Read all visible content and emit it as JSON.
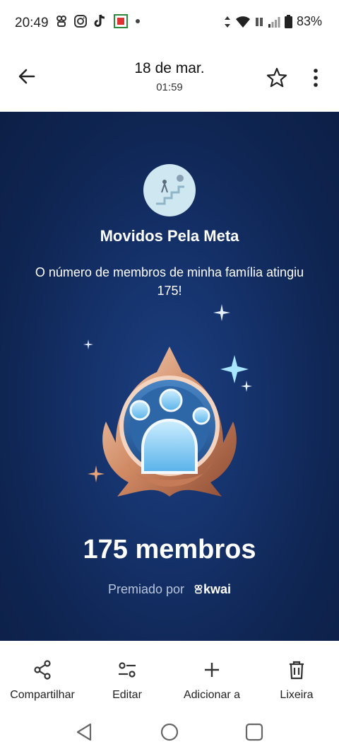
{
  "status": {
    "time": "20:49",
    "battery": "83%"
  },
  "header": {
    "title": "18 de mar.",
    "subtitle": "01:59"
  },
  "image": {
    "title": "Movidos Pela Meta",
    "message": "O número de membros de minha família atingiu 175!",
    "count": "175 membros",
    "awarded_by": "Premiado por",
    "brand": "kwai"
  },
  "actions": [
    {
      "label": "Compartilhar",
      "icon": "share-icon"
    },
    {
      "label": "Editar",
      "icon": "edit-icon"
    },
    {
      "label": "Adicionar a",
      "icon": "add-icon"
    },
    {
      "label": "Lixeira",
      "icon": "trash-icon"
    }
  ]
}
